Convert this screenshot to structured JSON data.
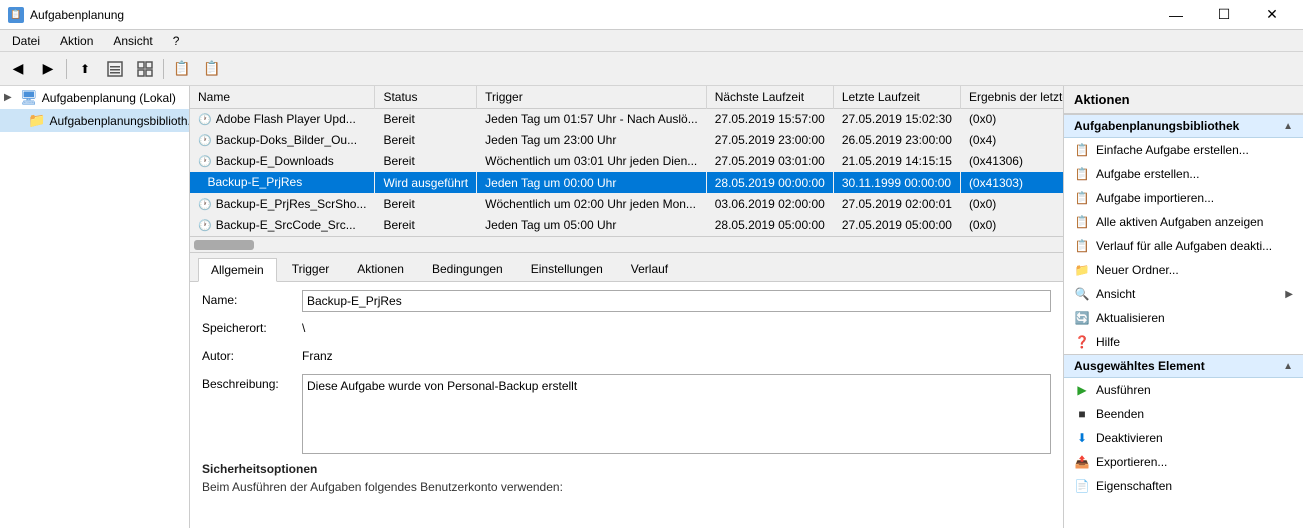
{
  "titleBar": {
    "icon": "📋",
    "title": "Aufgabenplanung",
    "minBtn": "—",
    "maxBtn": "☐",
    "closeBtn": "✕"
  },
  "menuBar": {
    "items": [
      "Datei",
      "Aktion",
      "Ansicht",
      "?"
    ]
  },
  "toolbar": {
    "buttons": [
      "◀",
      "▶",
      "⬆",
      "⬜",
      "⬛",
      "📋",
      "📋"
    ]
  },
  "sidebar": {
    "items": [
      {
        "label": "Aufgabenplanung (Lokal)",
        "level": 0,
        "expanded": true,
        "type": "computer"
      },
      {
        "label": "Aufgabenplanungsbiblioth...",
        "level": 1,
        "expanded": false,
        "type": "folder"
      }
    ]
  },
  "table": {
    "columns": [
      "Name",
      "Status",
      "Trigger",
      "Nächste Laufzeit",
      "Letzte Laufzeit",
      "Ergebnis der letzten"
    ],
    "rows": [
      {
        "name": "Adobe Flash Player Upd...",
        "status": "Bereit",
        "trigger": "Jeden Tag um 01:57 Uhr - Nach Auslö...",
        "naechste": "27.05.2019 15:57:00",
        "letzte": "27.05.2019 15:02:30",
        "ergebnis": "(0x0)",
        "selected": false,
        "running": false
      },
      {
        "name": "Backup-Doks_Bilder_Ou...",
        "status": "Bereit",
        "trigger": "Jeden Tag um 23:00 Uhr",
        "naechste": "27.05.2019 23:00:00",
        "letzte": "26.05.2019 23:00:00",
        "ergebnis": "(0x4)",
        "selected": false,
        "running": false
      },
      {
        "name": "Backup-E_Downloads",
        "status": "Bereit",
        "trigger": "Wöchentlich um 03:01 Uhr jeden Dien...",
        "naechste": "27.05.2019 03:01:00",
        "letzte": "21.05.2019 14:15:15",
        "ergebnis": "(0x41306)",
        "selected": false,
        "running": false
      },
      {
        "name": "Backup-E_PrjRes",
        "status": "Wird ausgeführt",
        "trigger": "Jeden Tag um 00:00 Uhr",
        "naechste": "28.05.2019 00:00:00",
        "letzte": "30.11.1999 00:00:00",
        "ergebnis": "(0x41303)",
        "selected": true,
        "running": true
      },
      {
        "name": "Backup-E_PrjRes_ScrSho...",
        "status": "Bereit",
        "trigger": "Wöchentlich um 02:00 Uhr jeden Mon...",
        "naechste": "03.06.2019 02:00:00",
        "letzte": "27.05.2019 02:00:01",
        "ergebnis": "(0x0)",
        "selected": false,
        "running": false
      },
      {
        "name": "Backup-E_SrcCode_Src...",
        "status": "Bereit",
        "trigger": "Jeden Tag um 05:00 Uhr",
        "naechste": "28.05.2019 05:00:00",
        "letzte": "27.05.2019 05:00:00",
        "ergebnis": "(0x0)",
        "selected": false,
        "running": false
      }
    ]
  },
  "detailTabs": {
    "tabs": [
      "Allgemein",
      "Trigger",
      "Aktionen",
      "Bedingungen",
      "Einstellungen",
      "Verlauf"
    ],
    "activeTab": "Allgemein"
  },
  "detailForm": {
    "nameLabel": "Name:",
    "nameValue": "Backup-E_PrjRes",
    "speicherortLabel": "Speicherort:",
    "speicherortValue": "\\",
    "autorLabel": "Autor:",
    "autorValue": "Franz",
    "beschreibungLabel": "Beschreibung:",
    "beschreibungValue": "Diese Aufgabe wurde von Personal-Backup erstellt",
    "sicherheitsHeader": "Sicherheitsoptionen",
    "sicherheitsText": "Beim Ausführen der Aufgaben folgendes Benutzerkonto verwenden:"
  },
  "actionsPanel": {
    "header": "Aktionen",
    "sections": [
      {
        "title": "Aufgabenplanungsbibliothek",
        "items": [
          {
            "label": "Einfache Aufgabe erstellen...",
            "icon": "📋"
          },
          {
            "label": "Aufgabe erstellen...",
            "icon": "📋"
          },
          {
            "label": "Aufgabe importieren...",
            "icon": "📋"
          },
          {
            "label": "Alle aktiven Aufgaben anzeigen",
            "icon": "📋"
          },
          {
            "label": "Verlauf für alle Aufgaben deakti...",
            "icon": "📋"
          },
          {
            "label": "Neuer Ordner...",
            "icon": "📁",
            "isFolder": true
          },
          {
            "label": "Ansicht",
            "icon": "🔍",
            "hasSubmenu": true
          },
          {
            "label": "Aktualisieren",
            "icon": "🔄"
          },
          {
            "label": "Hilfe",
            "icon": "❓"
          }
        ]
      },
      {
        "title": "Ausgewähltes Element",
        "items": [
          {
            "label": "Ausführen",
            "icon": "▶",
            "isPlay": true
          },
          {
            "label": "Beenden",
            "icon": "■",
            "isStop": true
          },
          {
            "label": "Deaktivieren",
            "icon": "⬇",
            "isDown": true
          },
          {
            "label": "Exportieren...",
            "icon": "📤"
          },
          {
            "label": "Eigenschaften",
            "icon": "📄"
          }
        ]
      }
    ]
  }
}
